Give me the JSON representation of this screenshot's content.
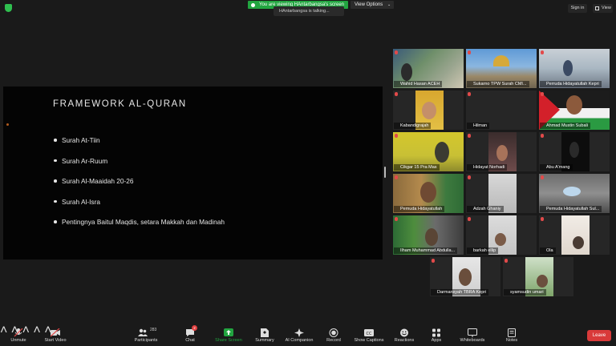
{
  "topbar": {
    "viewing_label": "You are viewing HAntarbangsa's screen",
    "view_options_label": "View Options",
    "talking_label": "HAntarbangsa is talking...",
    "sign_in_label": "Sign in",
    "view_label": "View"
  },
  "slide": {
    "title": "FRAMEWORK AL-QURAN",
    "bullets": [
      "Surah At-Tiin",
      "Surah Ar-Ruum",
      "Surah Al-Maaidah 20-26",
      "Surah Al-Isra",
      "Pentingnya Baitul Maqdis, setara Makkah dan Madinah"
    ]
  },
  "participants": [
    {
      "name": "Wahid Hasan ACEH"
    },
    {
      "name": "Sukarno TPW Surah CMI..."
    },
    {
      "name": "Perruda Hidayatullah Kepri"
    },
    {
      "name": "Kabandigrajah"
    },
    {
      "name": "Hilman"
    },
    {
      "name": "Ahmad Mustin Subali"
    },
    {
      "name": "Cikgar 15 Pra Mas"
    },
    {
      "name": "Hidayat Norhadi"
    },
    {
      "name": "Abu A'mang"
    },
    {
      "name": "Pemuda Hidayatullah"
    },
    {
      "name": "Adzah Ghaniy"
    },
    {
      "name": "Pemuda Hidayatullah Sul..."
    },
    {
      "name": "Ilham Muhammad Abdulla..."
    },
    {
      "name": "barkah ellip"
    },
    {
      "name": "Ola"
    },
    {
      "name": "Darmansyah TBRA Kepri"
    },
    {
      "name": "syamsudin umari"
    }
  ],
  "toolbar": {
    "unmute": "Unmute",
    "start_video": "Start Video",
    "participants": "Participants",
    "participants_count": "283",
    "chat": "Chat",
    "chat_badge": "2",
    "share_screen": "Share Screen",
    "summary": "Summary",
    "ai_companion": "AI Companion",
    "record": "Record",
    "show_captions": "Show Captions",
    "reactions": "Reactions",
    "apps": "Apps",
    "whiteboards": "Whiteboards",
    "notes": "Notes",
    "leave": "Leave"
  },
  "colors": {
    "background": "#1a1a1a",
    "share_green": "#22a540",
    "leave_red": "#d93a3a",
    "mic_muted_red": "#e24a4a"
  },
  "icons": [
    "shield-icon",
    "grid-icon",
    "mic-off-icon",
    "video-off-icon",
    "participants-icon",
    "chat-icon",
    "share-screen-icon",
    "summary-icon",
    "ai-companion-icon",
    "record-icon",
    "captions-icon",
    "reactions-icon",
    "apps-icon",
    "whiteboards-icon",
    "notes-icon"
  ]
}
